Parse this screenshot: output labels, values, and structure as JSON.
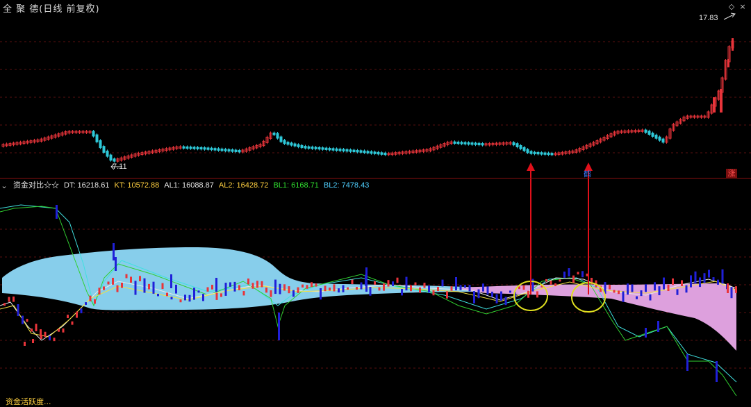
{
  "window": {
    "title": "全 聚 德(日线 前复权)",
    "collapse_icon": "collapse-icon",
    "diamond_icon": "diamond-icon",
    "close_icon": "close-icon"
  },
  "price_panel": {
    "high_label": "17.83",
    "low_label": "7.11",
    "badge": "涨",
    "marker_text": "鹤"
  },
  "indicator": {
    "name": "资金对比☆☆",
    "dt": "DT: 16218.61",
    "kt": "KT: 10572.88",
    "al1": "AL1: 16088.87",
    "al2": "AL2: 16428.72",
    "bl1": "BL1: 6168.71",
    "bl2": "BL2: 7478.43",
    "bottom_text": "资金活跃度..."
  },
  "colors": {
    "up": "#e8343a",
    "down": "#2ec8d8",
    "ind_up": "#e8343a",
    "ind_down": "#2020d8",
    "cloud_blue": "#87ceeb",
    "cloud_pink": "#dda0dd",
    "grid": "#5a1010",
    "annotation": "#e0101a",
    "circle": "#e0e020"
  }
}
